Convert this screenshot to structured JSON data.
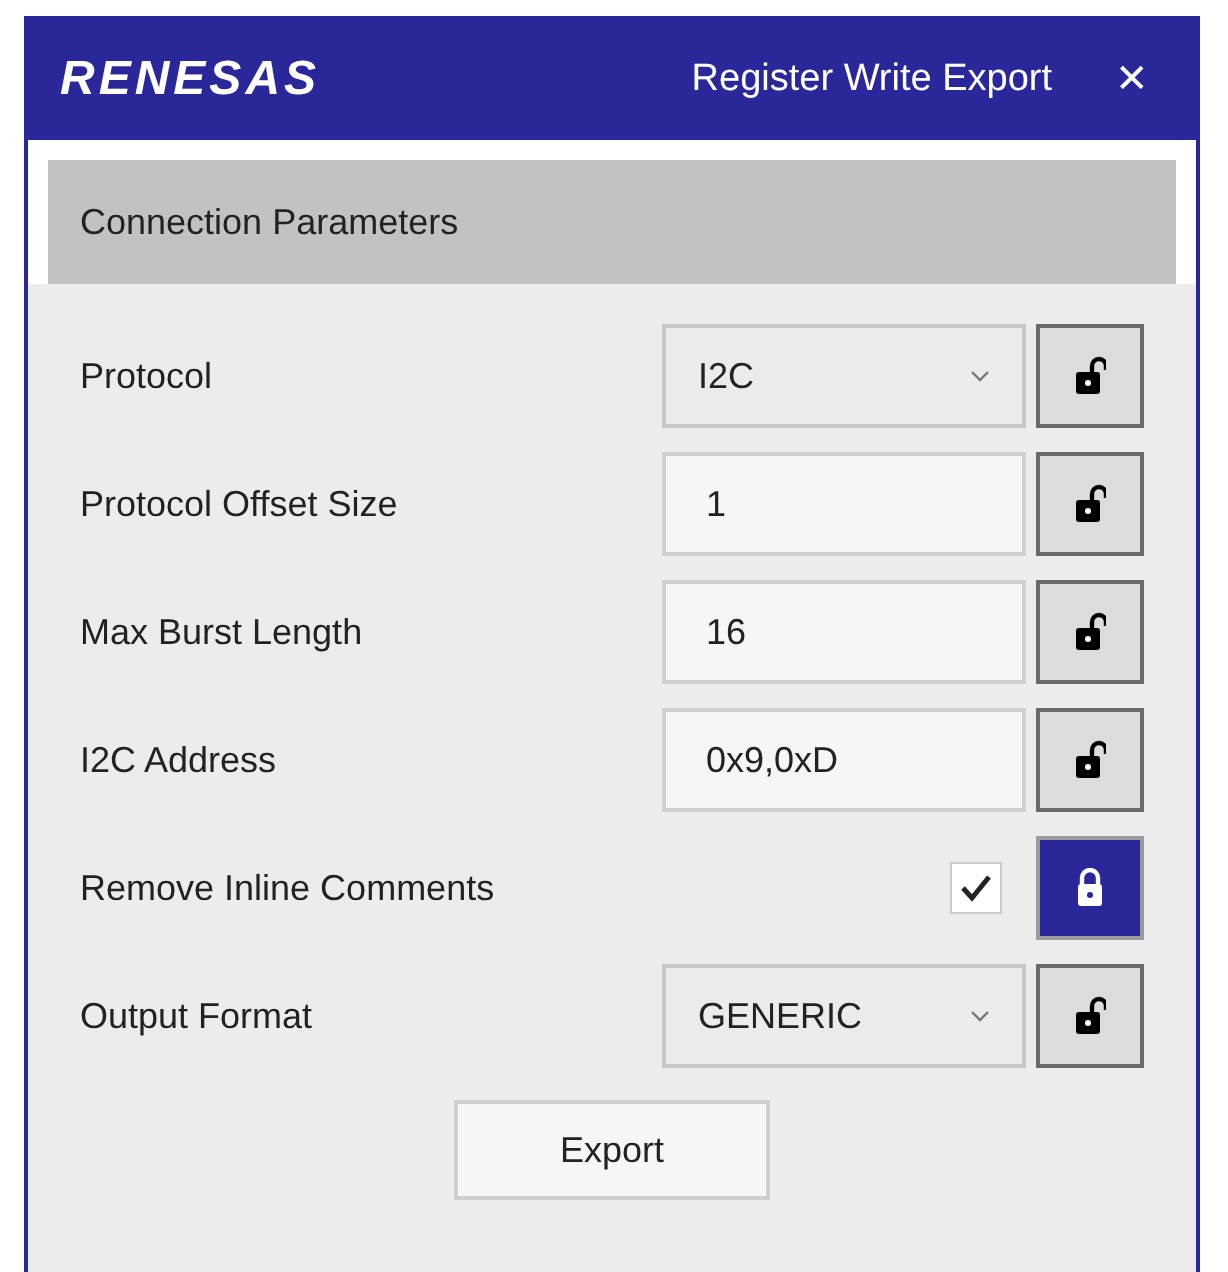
{
  "window": {
    "logo": "RENESAS",
    "title": "Register Write Export",
    "close": "✕"
  },
  "section": {
    "title": "Connection Parameters"
  },
  "rows": [
    {
      "label": "Protocol",
      "kind": "dropdown",
      "value": "I2C",
      "locked": false
    },
    {
      "label": "Protocol Offset Size",
      "kind": "text",
      "value": "1",
      "locked": false
    },
    {
      "label": "Max Burst Length",
      "kind": "text",
      "value": "16",
      "locked": false
    },
    {
      "label": "I2C Address",
      "kind": "text",
      "value": "0x9,0xD",
      "locked": false
    },
    {
      "label": "Remove Inline Comments",
      "kind": "checkbox",
      "checked": true,
      "locked": true
    },
    {
      "label": "Output Format",
      "kind": "dropdown",
      "value": "GENERIC",
      "locked": false
    }
  ],
  "export_button": "Export"
}
